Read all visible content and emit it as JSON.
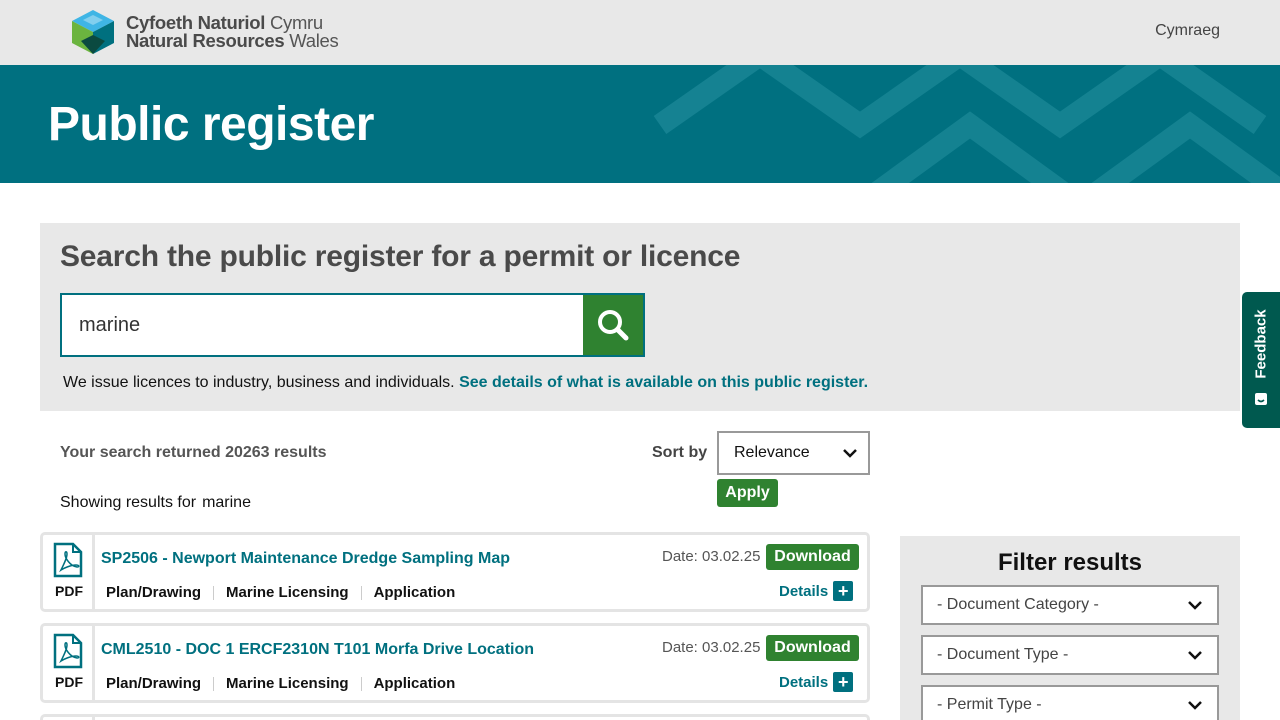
{
  "header": {
    "logo_line1_bold": "Cyfoeth Naturiol",
    "logo_line1_rest": "Cymru",
    "logo_line2_bold": "Natural Resources",
    "logo_line2_rest": "Wales",
    "language_link": "Cymraeg"
  },
  "hero": {
    "title": "Public register"
  },
  "search": {
    "heading": "Search the public register for a permit or licence",
    "query": "marine",
    "button_icon": "search-icon",
    "info_text": "We issue licences to industry, business and individuals.",
    "info_link": "See details of what is available on this public register."
  },
  "results": {
    "count_text": "Your search returned 20263 results",
    "showing_label": "Showing results for",
    "showing_term": "marine",
    "sort_label": "Sort by",
    "sort_value": "Relevance",
    "apply_label": "Apply",
    "items": [
      {
        "file_type": "PDF",
        "title": "SP2506 - Newport Maintenance Dredge Sampling Map",
        "tags": [
          "Plan/Drawing",
          "Marine Licensing",
          "Application"
        ],
        "date": "Date: 03.02.25",
        "download_label": "Download",
        "details_label": "Details"
      },
      {
        "file_type": "PDF",
        "title": "CML2510 - DOC 1 ERCF2310N T101 Morfa Drive Location",
        "tags": [
          "Plan/Drawing",
          "Marine Licensing",
          "Application"
        ],
        "date": "Date: 03.02.25",
        "download_label": "Download",
        "details_label": "Details"
      }
    ]
  },
  "filters": {
    "heading": "Filter results",
    "selects": [
      "- Document Category -",
      "- Document Type -",
      "- Permit Type -"
    ]
  },
  "feedback": {
    "label": "Feedback"
  },
  "colors": {
    "teal": "#007080",
    "green": "#2f8230",
    "panel_grey": "#e8e8e8",
    "feedback_green": "#00594f"
  }
}
